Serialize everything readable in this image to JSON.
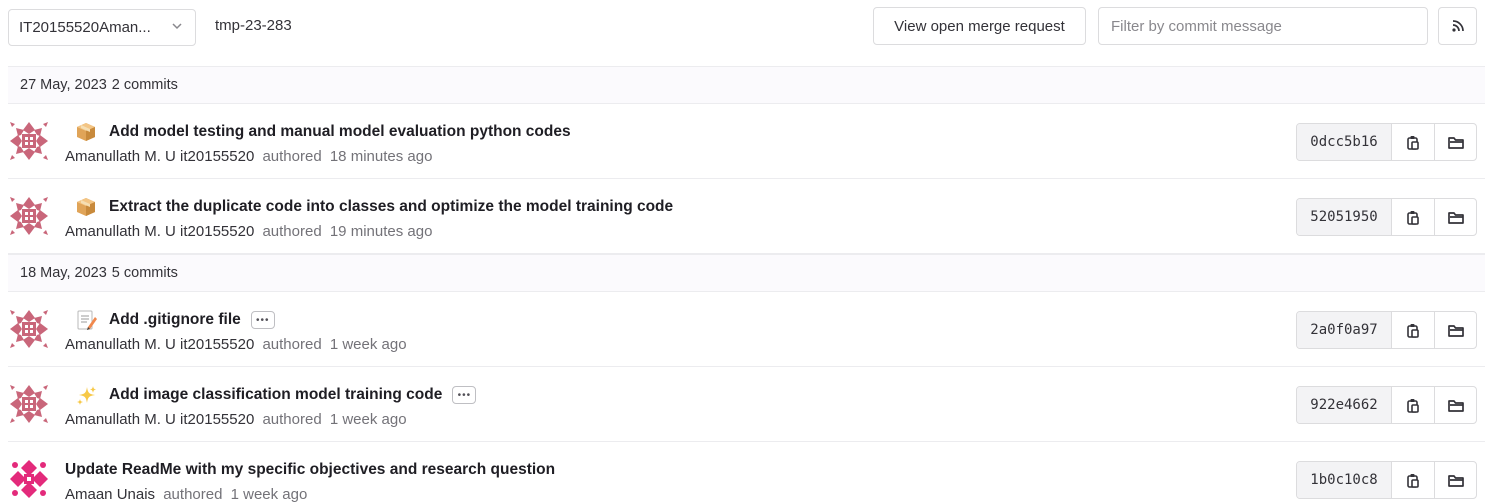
{
  "toolbar": {
    "branch_select": "IT20155520Aman...",
    "path": "tmp-23-283",
    "merge_request_button": "View open merge request",
    "filter_placeholder": "Filter by commit message"
  },
  "colors": {
    "avatar_primary": "#c9667a",
    "avatar_secondary": "#e32a7b",
    "border": "#dcdcde",
    "header_bg": "#fbfafd"
  },
  "days": [
    {
      "date": "27 May, 2023",
      "count": "2 commits",
      "commits": [
        {
          "emoji": "package-icon",
          "title": "Add model testing and manual model evaluation python codes",
          "author": "Amanullath M. U it20155520",
          "authored": "authored",
          "time": "18 minutes ago",
          "sha": "0dcc5b16"
        },
        {
          "emoji": "package-icon",
          "title": "Extract the duplicate code into classes and optimize the model training code",
          "author": "Amanullath M. U it20155520",
          "authored": "authored",
          "time": "19 minutes ago",
          "sha": "52051950"
        }
      ]
    },
    {
      "date": "18 May, 2023",
      "count": "5 commits",
      "commits": [
        {
          "emoji": "memo-icon",
          "title": "Add .gitignore file",
          "author": "Amanullath M. U it20155520",
          "authored": "authored",
          "time": "1 week ago",
          "sha": "2a0f0a97"
        },
        {
          "emoji": "sparkles-icon",
          "title": "Add image classification model training code",
          "author": "Amanullath M. U it20155520",
          "authored": "authored",
          "time": "1 week ago",
          "sha": "922e4662"
        },
        {
          "emoji": "",
          "title": "Update ReadMe with my specific objectives and research question",
          "author": "Amaan Unais",
          "authored": "authored",
          "time": "1 week ago",
          "sha": "1b0c10c8"
        }
      ]
    }
  ]
}
